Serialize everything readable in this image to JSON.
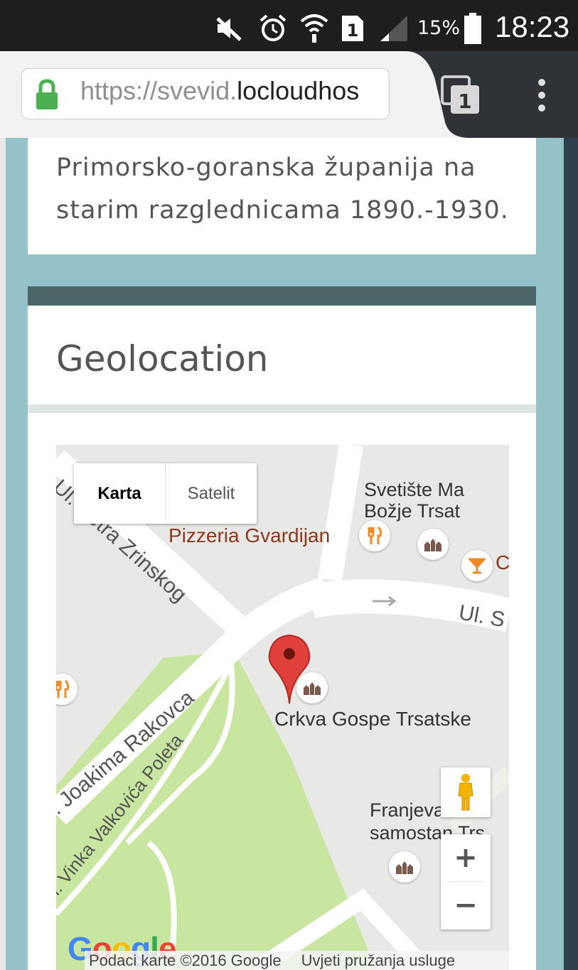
{
  "status_bar": {
    "battery_percent": "15%",
    "time": "18:23",
    "sim_slot": "1",
    "icons": [
      "mute-icon",
      "alarm-icon",
      "wifi-icon",
      "sim-icon",
      "signal-icon",
      "battery-icon"
    ]
  },
  "browser": {
    "url_prefix": "https://svevid.",
    "url_host": "locloudhos",
    "tab_count": "1",
    "icons": [
      "lock-icon",
      "tabs-icon",
      "overflow-menu-icon"
    ]
  },
  "content": {
    "description": "Primorsko-goranska županija na starim razglednicama 1890.-1930.",
    "geolocation_title": "Geolocation"
  },
  "map": {
    "map_type": {
      "karta": "Karta",
      "satelit": "Satelit",
      "selected": "Karta"
    },
    "labels": {
      "street_petra": "Ul. Petra Zrinskog",
      "street_joakima": "Ul. Joakima Rakovca",
      "street_vinka": "Ul. Vinka Valkovića Poleta",
      "street_s": "Ul. S",
      "pizzeria": "Pizzeria Gvardijan",
      "svetiste_1": "Svetište Ma",
      "svetiste_2": "Božje Trsat",
      "cafe": "C",
      "crkva": "Crkva Gospe Trsatske",
      "franjevacki_1": "Franjevački",
      "franjevacki_2": "samostan Trs"
    },
    "zoom_in": "+",
    "zoom_out": "−",
    "logo": "Google",
    "attribution": "Podaci karte ©2016 Google",
    "terms": "Uvjeti pružanja usluge",
    "colors": {
      "park": "#c8e6a0",
      "road": "#ffffff",
      "land": "#e8e8e6",
      "marker": "#e0403a",
      "poi_label": "#8a3a1c"
    }
  }
}
